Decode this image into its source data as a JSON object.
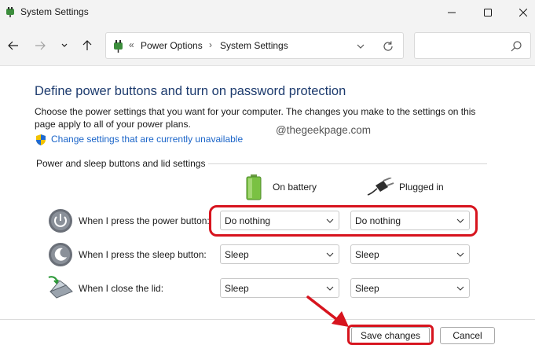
{
  "window": {
    "title": "System Settings",
    "controls": [
      "minimize-icon",
      "maximize-icon",
      "close-icon"
    ]
  },
  "address_bar": {
    "prefix": "«",
    "crumbs": [
      "Power Options",
      "System Settings"
    ],
    "separator": "›",
    "search_placeholder": ""
  },
  "content": {
    "heading": "Define power buttons and turn on password protection",
    "description": "Choose the power settings that you want for your computer. The changes you make to the settings on this page apply to all of your power plans.",
    "change_link": "Change settings that are currently unavailable",
    "watermark": "@thegeekpage.com",
    "group_label": "Power and sleep buttons and lid settings",
    "columns": {
      "battery": "On battery",
      "plugged": "Plugged in"
    },
    "rows": [
      {
        "label": "When I press the power button:",
        "icon": "power-button-icon",
        "battery": "Do nothing",
        "plugged": "Do nothing"
      },
      {
        "label": "When I press the sleep button:",
        "icon": "sleep-button-icon",
        "battery": "Sleep",
        "plugged": "Sleep"
      },
      {
        "label": "When I close the lid:",
        "icon": "laptop-lid-icon",
        "battery": "Sleep",
        "plugged": "Sleep"
      }
    ]
  },
  "footer": {
    "save_label": "Save changes",
    "cancel_label": "Cancel"
  },
  "colors": {
    "heading": "#1d3b6e",
    "link": "#1a64c8",
    "annotation_red": "#d7141e"
  }
}
